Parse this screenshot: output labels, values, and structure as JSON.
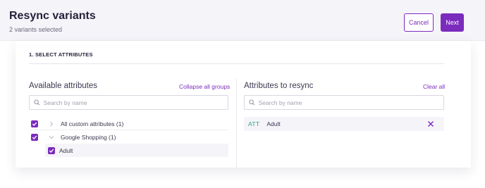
{
  "header": {
    "title": "Resync variants",
    "subtitle": "2 variants selected",
    "cancel_label": "Cancel",
    "next_label": "Next"
  },
  "section": {
    "title": "1. SELECT ATTRIBUTES"
  },
  "available": {
    "title": "Available attributes",
    "collapse_label": "Collapse all groups",
    "search_placeholder": "Search by name",
    "groups": [
      {
        "label": "All custom attributes (1)",
        "checked": true,
        "expanded": false
      },
      {
        "label": "Google Shopping (1)",
        "checked": true,
        "expanded": true,
        "items": [
          {
            "label": "Adult",
            "checked": true
          }
        ]
      }
    ]
  },
  "resync": {
    "title": "Attributes to resync",
    "clear_label": "Clear all",
    "search_placeholder": "Search by name",
    "selected": [
      {
        "badge": "ATT",
        "label": "Adult"
      }
    ]
  },
  "colors": {
    "accent": "#7b2bbd",
    "badge": "#2ea382",
    "header_bg": "#f5f4f9"
  }
}
